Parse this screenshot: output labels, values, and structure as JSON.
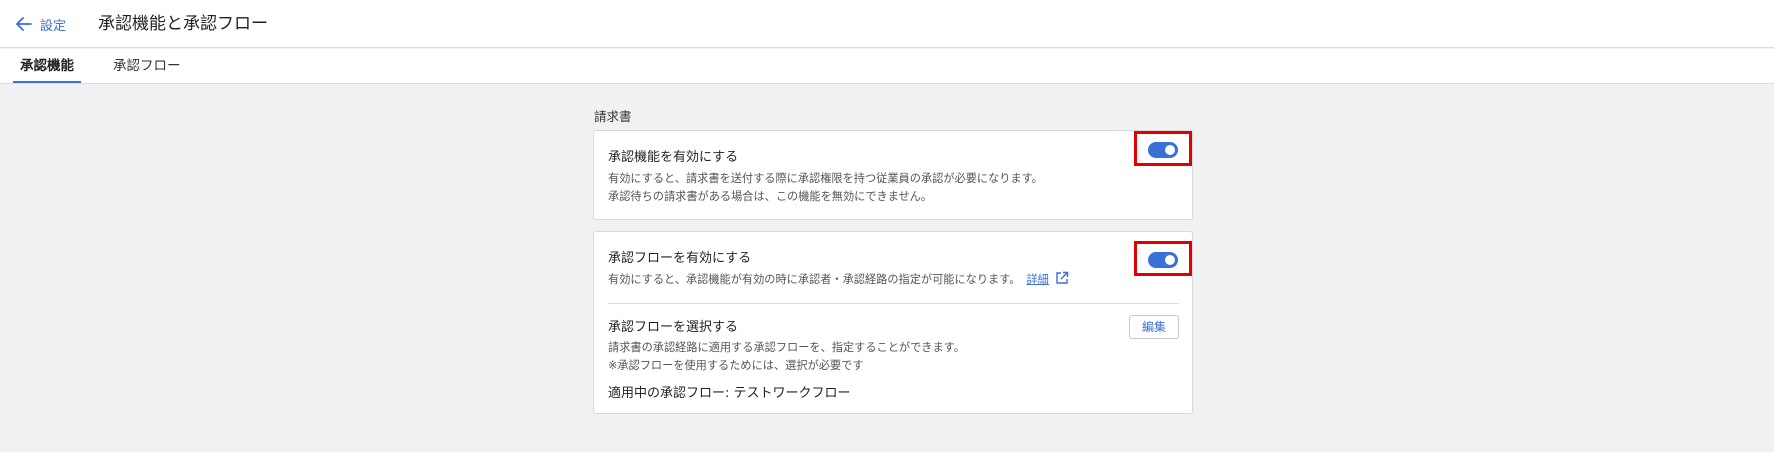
{
  "header": {
    "back_label": "設定",
    "title": "承認機能と承認フロー"
  },
  "tabs": [
    {
      "label": "承認機能",
      "active": true
    },
    {
      "label": "承認フロー",
      "active": false
    }
  ],
  "section": {
    "label": "請求書"
  },
  "approval_feature": {
    "title": "承認機能を有効にする",
    "desc1": "有効にすると、請求書を送付する際に承認権限を持つ従業員の承認が必要になります。",
    "desc2": "承認待ちの請求書がある場合は、この機能を無効にできません。",
    "enabled": true
  },
  "approval_flow": {
    "title": "承認フローを有効にする",
    "desc": "有効にすると、承認機能が有効の時に承認者・承認経路の指定が可能になります。",
    "detail_link": "詳細",
    "enabled": true
  },
  "flow_select": {
    "title": "承認フローを選択する",
    "desc1": "請求書の承認経路に適用する承認フローを、指定することができます。",
    "desc2": "※承認フローを使用するためには、選択が必要です",
    "edit_label": "編集",
    "applied": "適用中の承認フロー: テストワークフロー"
  },
  "colors": {
    "accent": "#3a6fd8",
    "highlight": "#e00000"
  }
}
